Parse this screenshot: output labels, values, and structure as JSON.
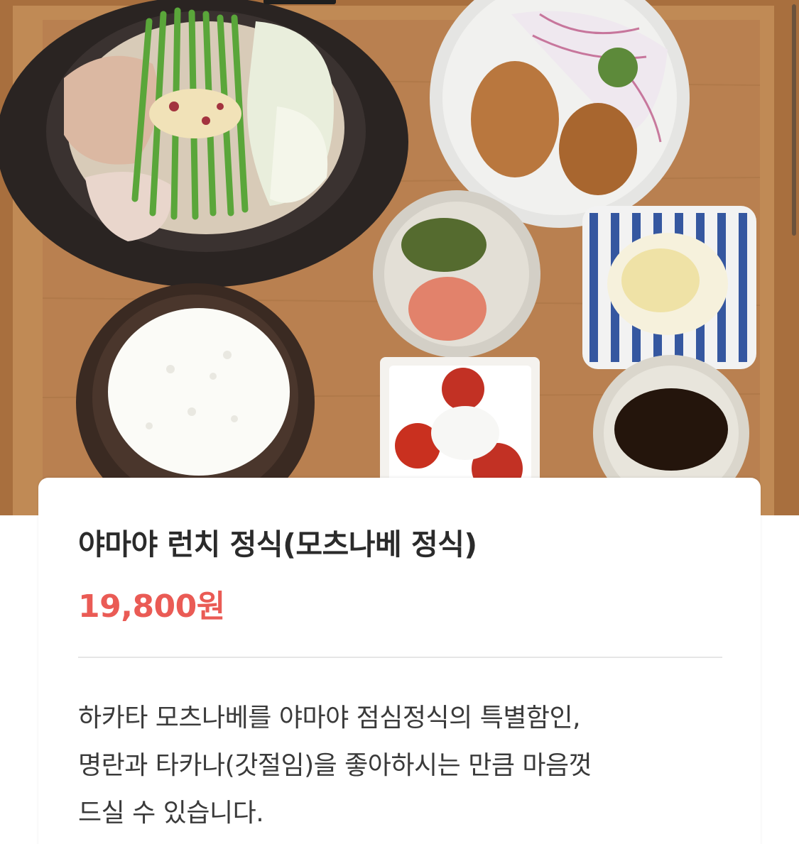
{
  "product": {
    "title": "야마야 런치 정식(모츠나베 정식)",
    "price": "19,800원",
    "description_lines": [
      "하카타 모츠나베를 야마야 점심정식의 특별함인,",
      "명란과 타카나(갓절임)을 좋아하시는 만큼 마음껏",
      "드실 수 있습니다."
    ]
  },
  "colors": {
    "price": "#ea5b55",
    "title": "#2b2b2b",
    "tray_wood": "#b07a48"
  }
}
